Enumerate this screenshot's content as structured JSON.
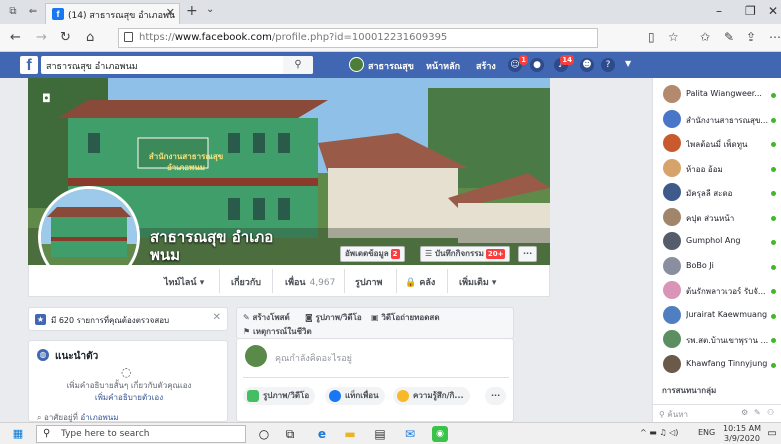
{
  "browser": {
    "tab_title": "(14) สาธารณสุข อำเภอพน",
    "url_prefix": "https://",
    "url_domain": "www.facebook.com",
    "url_path": "/profile.php?id=100012231609395"
  },
  "fb": {
    "search_value": "สาธารณสุข อำเภอพนม",
    "nav_name": "สาธารณสุข",
    "nav_home": "หน้าหลัก",
    "nav_create": "สร้าง",
    "badge_friends": "1",
    "badge_notif": "14"
  },
  "profile": {
    "name": "สาธารณสุข อำเภอพนม",
    "sign_text": "สำนักงานสาธารณสุข อำเภอพนม",
    "update_info": "อัพเดตข้อมูล",
    "update_badge": "2",
    "activity_log": "บันทึกกิจกรรม",
    "activity_badge": "20+",
    "more": "···",
    "nav": {
      "timeline": "ไทม์ไลน์",
      "about": "เกี่ยวกับ",
      "friends": "เพื่อน",
      "friends_count": "4,967",
      "photos": "รูปภาพ",
      "archive": "คลัง",
      "more": "เพิ่มเติม"
    }
  },
  "left": {
    "pending_text": "มี 620 รายการที่คุณต้องตรวจสอบ",
    "intro_title": "แนะนำตัว",
    "intro_desc": "เพิ่มคำอธิบายสั้นๆ เกี่ยวกับตัวคุณเอง",
    "intro_link": "เพิ่มคำอธิบายตัวเอง",
    "work_text": "อาศัยอยู่ที่",
    "work_link": "อำเภอพนม"
  },
  "composer": {
    "create_post": "สร้างโพสต์",
    "photo_video": "รูปภาพ/วิดีโอ",
    "live_video": "วิดีโอถ่ายทอดสด",
    "life_event": "เหตุการณ์ในชีวิต",
    "placeholder": "คุณกำลังคิดอะไรอยู่",
    "chip_photo": "รูปภาพ/วิดีโอ",
    "chip_tag": "แท็กเพื่อน",
    "chip_feeling": "ความรู้สึก/กิ...",
    "chip_more": "···"
  },
  "chat": {
    "contacts": [
      {
        "name": "Palita Wiangweer...",
        "color": "#b48a6e"
      },
      {
        "name": "สำนักงานสาธารณสุข...",
        "color": "#4a76c9"
      },
      {
        "name": "ไพลต้อนมี่ เพ็ดทูน",
        "color": "#c85a2e"
      },
      {
        "name": "ห้าออ อ้อม",
        "color": "#d6a46b"
      },
      {
        "name": "มัครุลลี สะดอ",
        "color": "#3d5a8a"
      },
      {
        "name": "คปุต ส่วนหน้า",
        "color": "#a0856a"
      },
      {
        "name": "Gumphol Ang",
        "color": "#555d6b"
      },
      {
        "name": "BoBo Ji",
        "color": "#8a8fa0"
      },
      {
        "name": "ต้นรักพลาวเวอร์ รับจั...",
        "color": "#d994b8"
      },
      {
        "name": "Jurairat Kaewmuang",
        "color": "#4f7fc0"
      },
      {
        "name": "รพ.สต.บ้านเขาพุราน ...",
        "color": "#5b8f62"
      },
      {
        "name": "Khawfang Tinnyjung",
        "color": "#6b5a4a"
      }
    ],
    "group_label": "การสนทนากลุ่ม",
    "search_placeholder": "ค้นหา"
  },
  "taskbar": {
    "search_placeholder": "Type here to search",
    "lang": "ENG",
    "time": "10:15 AM",
    "date": "3/9/2020"
  }
}
